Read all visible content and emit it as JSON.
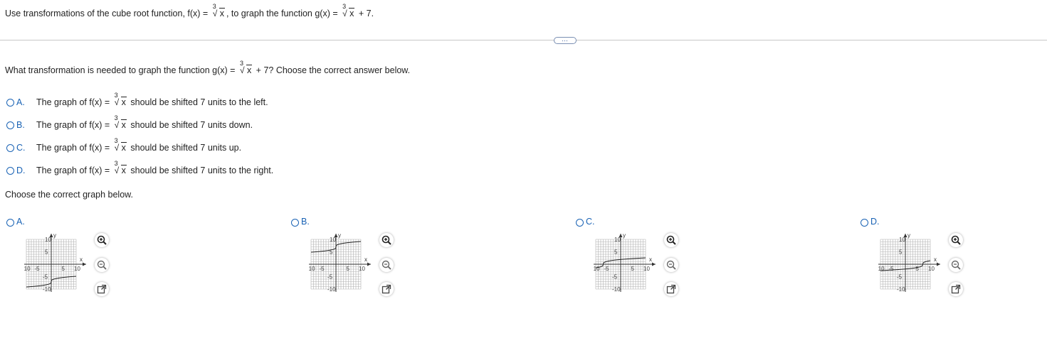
{
  "question": {
    "intro": "Use transformations of the cube root function, f(x) =",
    "intro_mid": ", to graph the function g(x) =",
    "intro_end": "+ 7.",
    "radicand": "x",
    "index": "3"
  },
  "more_button": "…",
  "part1": {
    "prompt_start": "What transformation is needed to graph the function g(x) =",
    "prompt_end": "+ 7? Choose the correct answer below.",
    "options": [
      {
        "letter": "A.",
        "pre": "The graph of f(x) =",
        "post": "should be shifted 7 units to the left."
      },
      {
        "letter": "B.",
        "pre": "The graph of f(x) =",
        "post": "should be shifted 7 units down."
      },
      {
        "letter": "C.",
        "pre": "The graph of f(x) =",
        "post": "should be shifted 7 units up."
      },
      {
        "letter": "D.",
        "pre": "The graph of f(x) =",
        "post": "should be shifted 7 units to the right."
      }
    ]
  },
  "part2": {
    "prompt": "Choose the correct graph below.",
    "graphs": [
      {
        "letter": "A.",
        "shift_x": 0,
        "shift_y": -7
      },
      {
        "letter": "B.",
        "shift_x": 0,
        "shift_y": 7
      },
      {
        "letter": "C.",
        "shift_x": -7,
        "shift_y": 0
      },
      {
        "letter": "D.",
        "shift_x": 7,
        "shift_y": 0
      }
    ],
    "axis": {
      "x_label": "x",
      "y_label": "y",
      "min": -10,
      "max": 10,
      "ticks": [
        "-10",
        "-5",
        "5",
        "10"
      ],
      "yticks": [
        "10",
        "5",
        "-5",
        "-10"
      ]
    }
  },
  "icons": {
    "zoom_in": "zoom-in-icon",
    "zoom_out": "zoom-out-icon",
    "popout": "popout-icon"
  }
}
